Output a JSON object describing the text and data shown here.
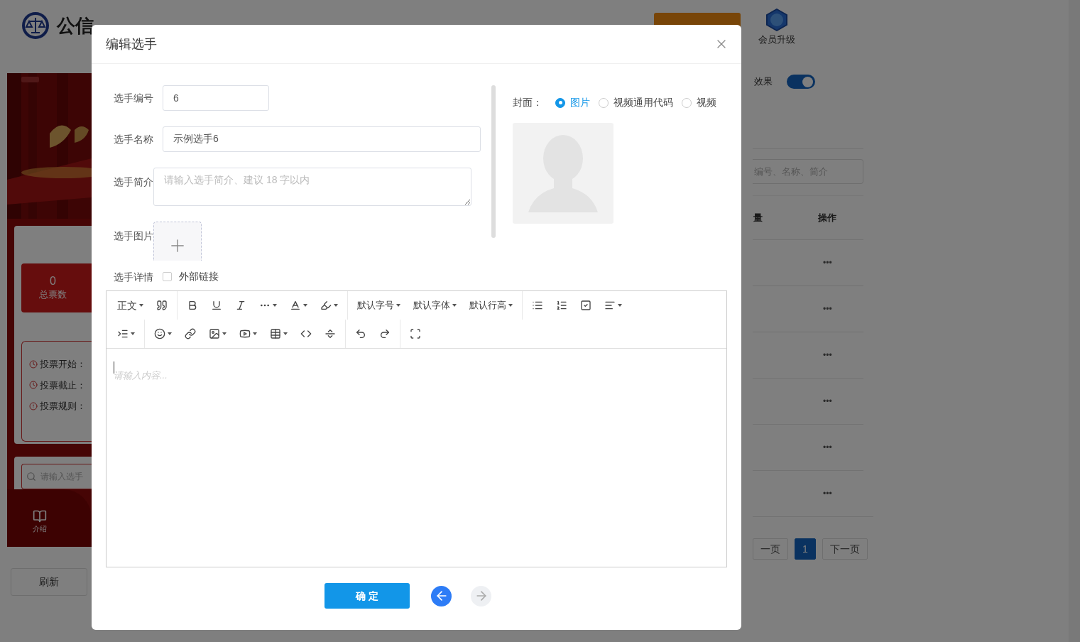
{
  "header": {
    "logo_text": "公信",
    "vip_label": "会员升级"
  },
  "preview": {
    "stat_value": "0",
    "stat_label": "总票数",
    "info": [
      {
        "kind": "clock",
        "label": "投票开始："
      },
      {
        "kind": "clock",
        "label": "投票截止："
      },
      {
        "kind": "alert",
        "label": "投票规则："
      }
    ],
    "search_placeholder": "请输入选手",
    "nav_label": "介绍"
  },
  "refresh_button": "刷新",
  "right_panel": {
    "toggle_label": "效果",
    "toggle_on": true,
    "search_placeholder": "编号、名称、简介",
    "columns": [
      "量",
      "操作"
    ],
    "rows": [
      {
        "action": "•••"
      },
      {
        "action": "•••"
      },
      {
        "action": "•••"
      },
      {
        "action": "•••"
      },
      {
        "action": "•••"
      },
      {
        "action": "•••"
      }
    ],
    "pagination": [
      {
        "label": "一页",
        "selected": false
      },
      {
        "label": "1",
        "selected": true
      },
      {
        "label": "下一页",
        "selected": false
      }
    ]
  },
  "modal": {
    "title": "编辑选手",
    "fields": [
      {
        "kind": "input",
        "label": "选手编号",
        "value": "6"
      },
      {
        "kind": "input",
        "label": "选手名称",
        "value": "示例选手6"
      },
      {
        "kind": "textarea",
        "label": "选手简介",
        "placeholder": "请输入选手简介、建议 18 字以内"
      },
      {
        "kind": "upload",
        "label": "选手图片"
      },
      {
        "kind": "checkbox",
        "label": "选手详情",
        "option": "外部链接",
        "checked": false
      }
    ],
    "cover": {
      "label": "封面：",
      "options": [
        {
          "label": "图片",
          "selected": true
        },
        {
          "label": "视频通用代码",
          "selected": false
        },
        {
          "label": "视频",
          "selected": false
        }
      ]
    },
    "editor": {
      "toolbar_labels": [
        "正文",
        "默认字号",
        "默认字体",
        "默认行高"
      ],
      "placeholder": "请输入内容..."
    },
    "confirm_button": "确 定"
  }
}
